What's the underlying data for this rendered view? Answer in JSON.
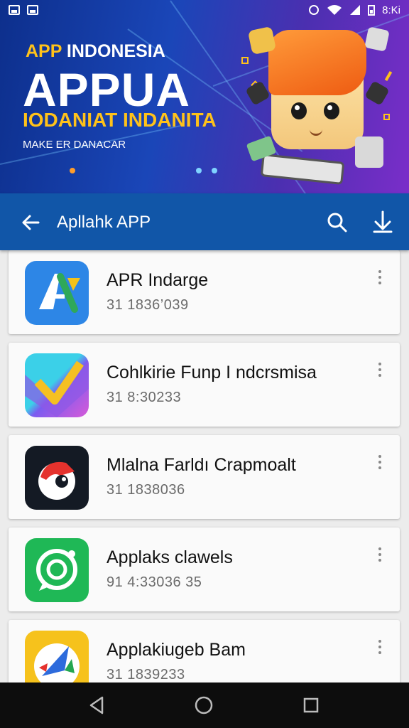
{
  "status_bar": {
    "time": "8:Ki"
  },
  "banner": {
    "brand_highlight": "APP",
    "brand_rest": " INDONESIA",
    "title": "APPUA",
    "subtitle": "IODANIAT INDANITA",
    "tagline": "MAKE ER DANACAR"
  },
  "app_bar": {
    "title": "Apllahk APP"
  },
  "apps": [
    {
      "name": "APR Indarge",
      "meta": "31 1836’039"
    },
    {
      "name": "Cohlkirie Funp I ndcrsmisa",
      "meta": "31 8:30233"
    },
    {
      "name": "Mlalna Farldı Crapmoalt",
      "meta": "31 1838036"
    },
    {
      "name": "Applaks clawels",
      "meta": "91 4:33036 35"
    },
    {
      "name": "Applakiugeb Bam",
      "meta": "31 1839233"
    }
  ],
  "colors": {
    "app_bar": "#1156a8",
    "banner_accent": "#ffc21a"
  }
}
